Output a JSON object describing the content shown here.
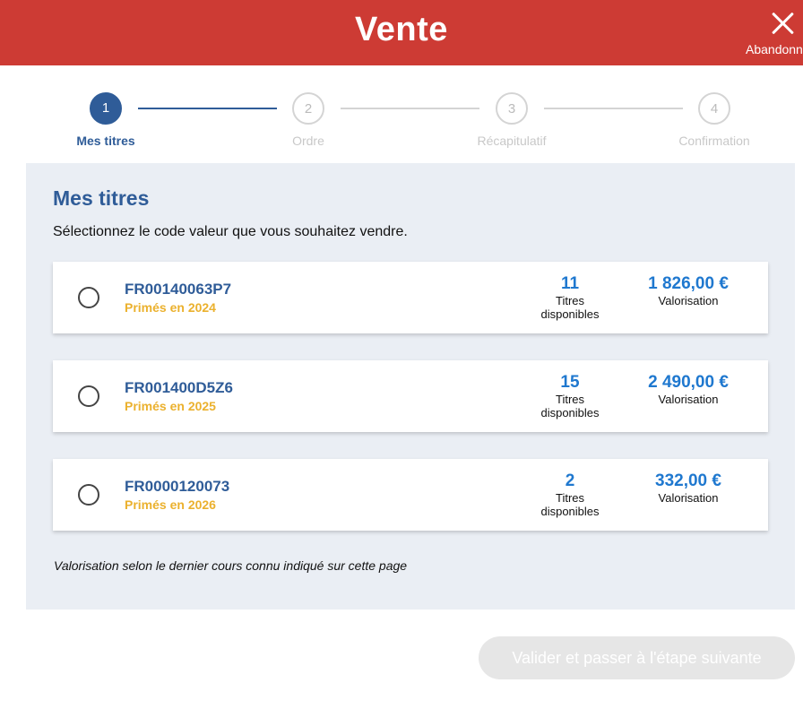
{
  "header": {
    "title": "Vente",
    "close_label": "Abandonner"
  },
  "stepper": {
    "steps": [
      {
        "number": "1",
        "label": "Mes titres",
        "state": "active"
      },
      {
        "number": "2",
        "label": "Ordre",
        "state": "inactive"
      },
      {
        "number": "3",
        "label": "Récapitulatif",
        "state": "inactive"
      },
      {
        "number": "4",
        "label": "Confirmation",
        "state": "inactive"
      }
    ]
  },
  "main": {
    "title": "Mes titres",
    "subtitle": "Sélectionnez le code valeur que vous souhaitez vendre.",
    "securities": [
      {
        "code": "FR00140063P7",
        "prime": "Primés en 2024",
        "quantity": "11",
        "quantity_label": "Titres disponibles",
        "valuation": "1 826,00 €",
        "valuation_label": "Valorisation",
        "selected": false
      },
      {
        "code": "FR001400D5Z6",
        "prime": "Primés en 2025",
        "quantity": "15",
        "quantity_label": "Titres disponibles",
        "valuation": "2 490,00 €",
        "valuation_label": "Valorisation",
        "selected": false
      },
      {
        "code": "FR0000120073",
        "prime": "Primés en 2026",
        "quantity": "2",
        "quantity_label": "Titres disponibles",
        "valuation": "332,00 €",
        "valuation_label": "Valorisation",
        "selected": false
      }
    ],
    "footnote": "Valorisation selon le dernier cours connu indiqué sur cette page"
  },
  "footer": {
    "submit_label": "Valider et passer à l'étape suivante",
    "submit_enabled": false
  },
  "colors": {
    "header_bg": "#cd3b34",
    "primary_blue": "#2f5c98",
    "value_blue": "#1f78cf",
    "prime_yellow": "#ebb12e",
    "panel_bg": "#eaeef4",
    "inactive_gray": "#c8c8c8",
    "button_disabled": "#e6e6e6"
  },
  "icons": {
    "close": "close-icon",
    "radio": "radio-unchecked-icon"
  }
}
